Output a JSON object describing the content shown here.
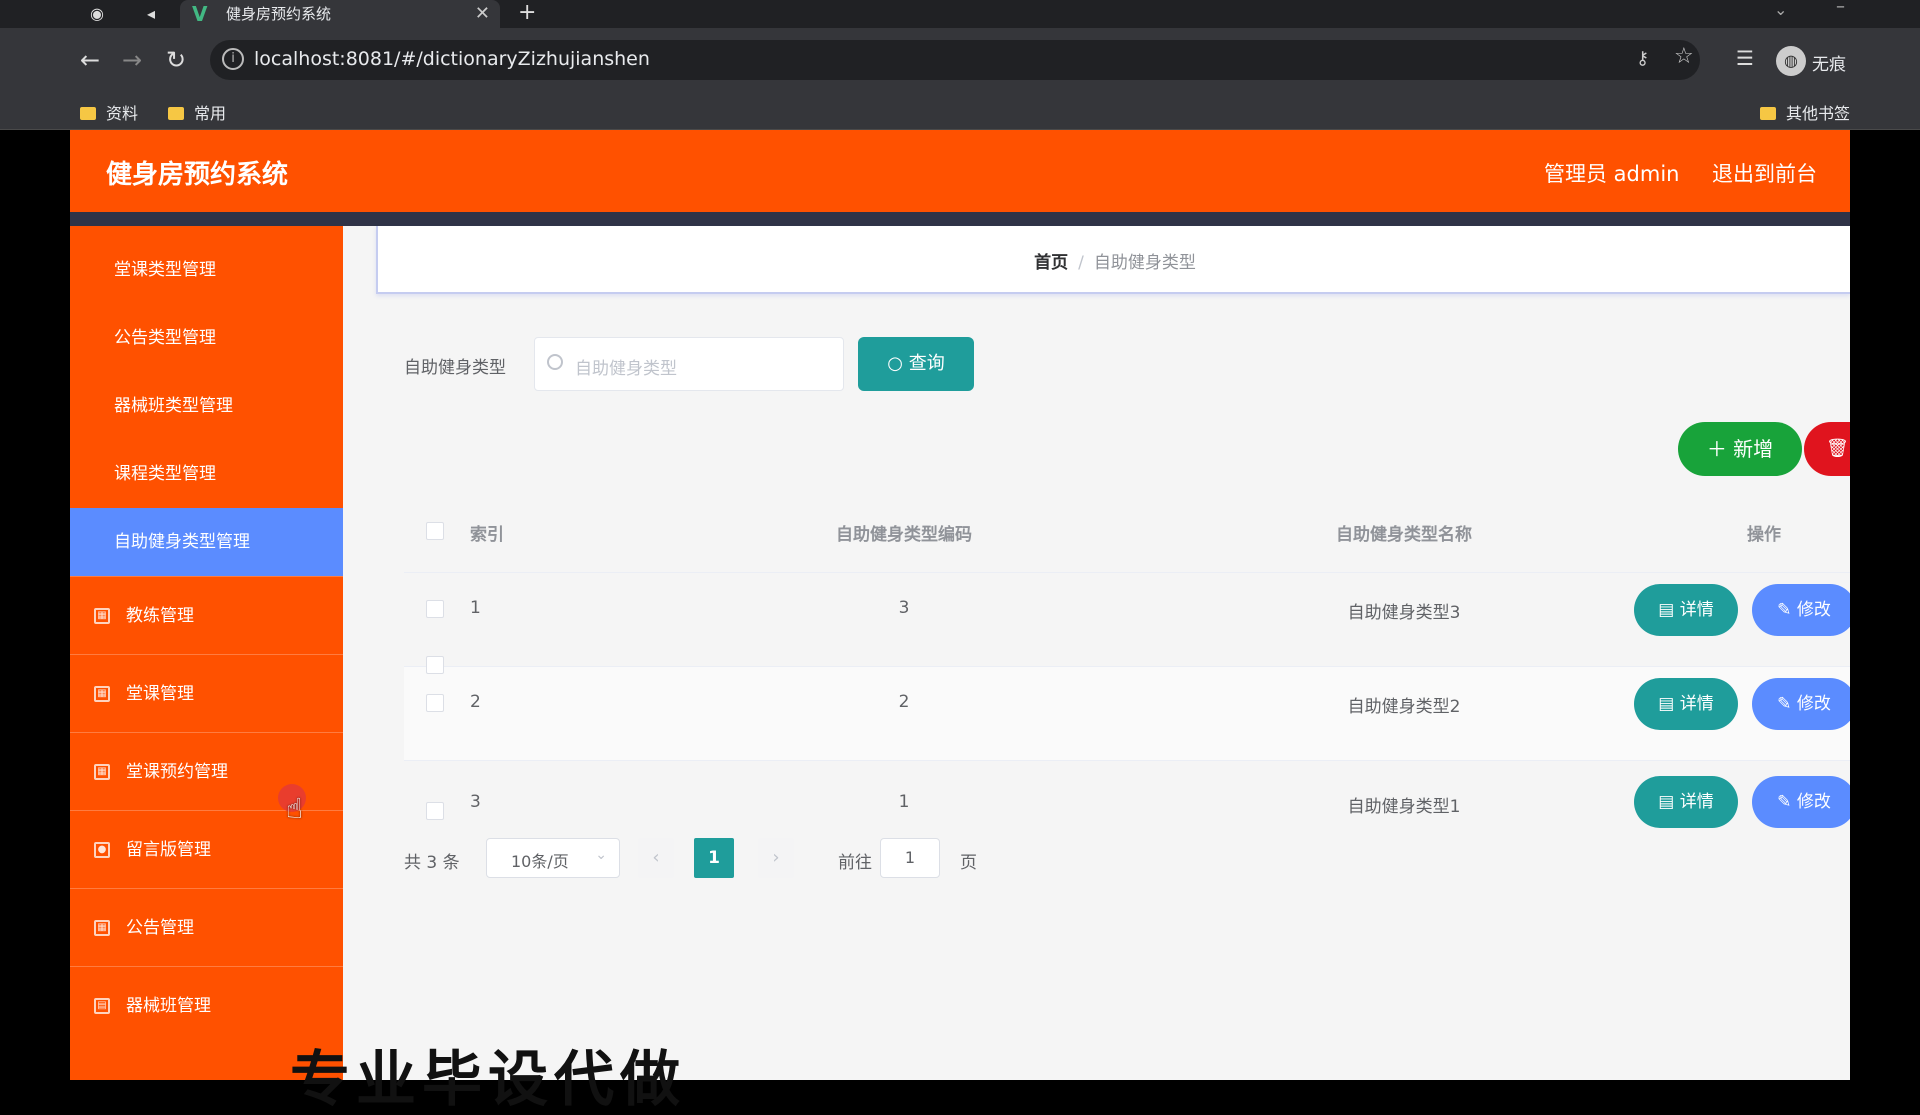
{
  "browser": {
    "tab_title": "健身房预约系统",
    "tab_favicon": "V",
    "url": "localhost:8081/#/dictionaryZizhujianshen",
    "bookmarks": [
      "资料",
      "常用"
    ],
    "other_bookmarks": "其他书签",
    "profile_label": "无痕"
  },
  "header": {
    "title": "健身房预约系统",
    "admin": "管理员 admin",
    "logout": "退出到前台"
  },
  "sidebar": {
    "sub_items": [
      {
        "label": "堂课类型管理"
      },
      {
        "label": "公告类型管理"
      },
      {
        "label": "器械班类型管理"
      },
      {
        "label": "课程类型管理"
      },
      {
        "label": "自助健身类型管理",
        "active": true
      }
    ],
    "main_items": [
      {
        "label": "教练管理",
        "icon": "grid-icon"
      },
      {
        "label": "堂课管理",
        "icon": "grid-icon"
      },
      {
        "label": "堂课预约管理",
        "icon": "grid-icon"
      },
      {
        "label": "留言版管理",
        "icon": "user-icon"
      },
      {
        "label": "公告管理",
        "icon": "grid-icon"
      },
      {
        "label": "器械班管理",
        "icon": "chart-icon"
      }
    ]
  },
  "breadcrumb": {
    "home": "首页",
    "separator": "/",
    "current": "自助健身类型"
  },
  "search": {
    "label": "自助健身类型",
    "placeholder": "自助健身类型",
    "button": "查询"
  },
  "toolbar": {
    "add": "新增"
  },
  "table": {
    "headers": {
      "index": "索引",
      "code": "自助健身类型编码",
      "name": "自助健身类型名称",
      "ops": "操作"
    },
    "rows": [
      {
        "index": "1",
        "code": "3",
        "name": "自助健身类型3"
      },
      {
        "index": "2",
        "code": "2",
        "name": "自助健身类型2"
      },
      {
        "index": "3",
        "code": "1",
        "name": "自助健身类型1"
      }
    ],
    "detail": "详情",
    "edit": "修改"
  },
  "pagination": {
    "total": "共 3 条",
    "page_size": "10条/页",
    "current_page": "1",
    "goto_label": "前往",
    "goto_value": "1",
    "page_suffix": "页"
  },
  "overlay_caption": "专业毕设代做",
  "colors": {
    "header": "#ff5100",
    "active_menu": "#5b8cff",
    "teal": "#1f9d9b",
    "green": "#18a33a",
    "red": "#e0141e"
  }
}
